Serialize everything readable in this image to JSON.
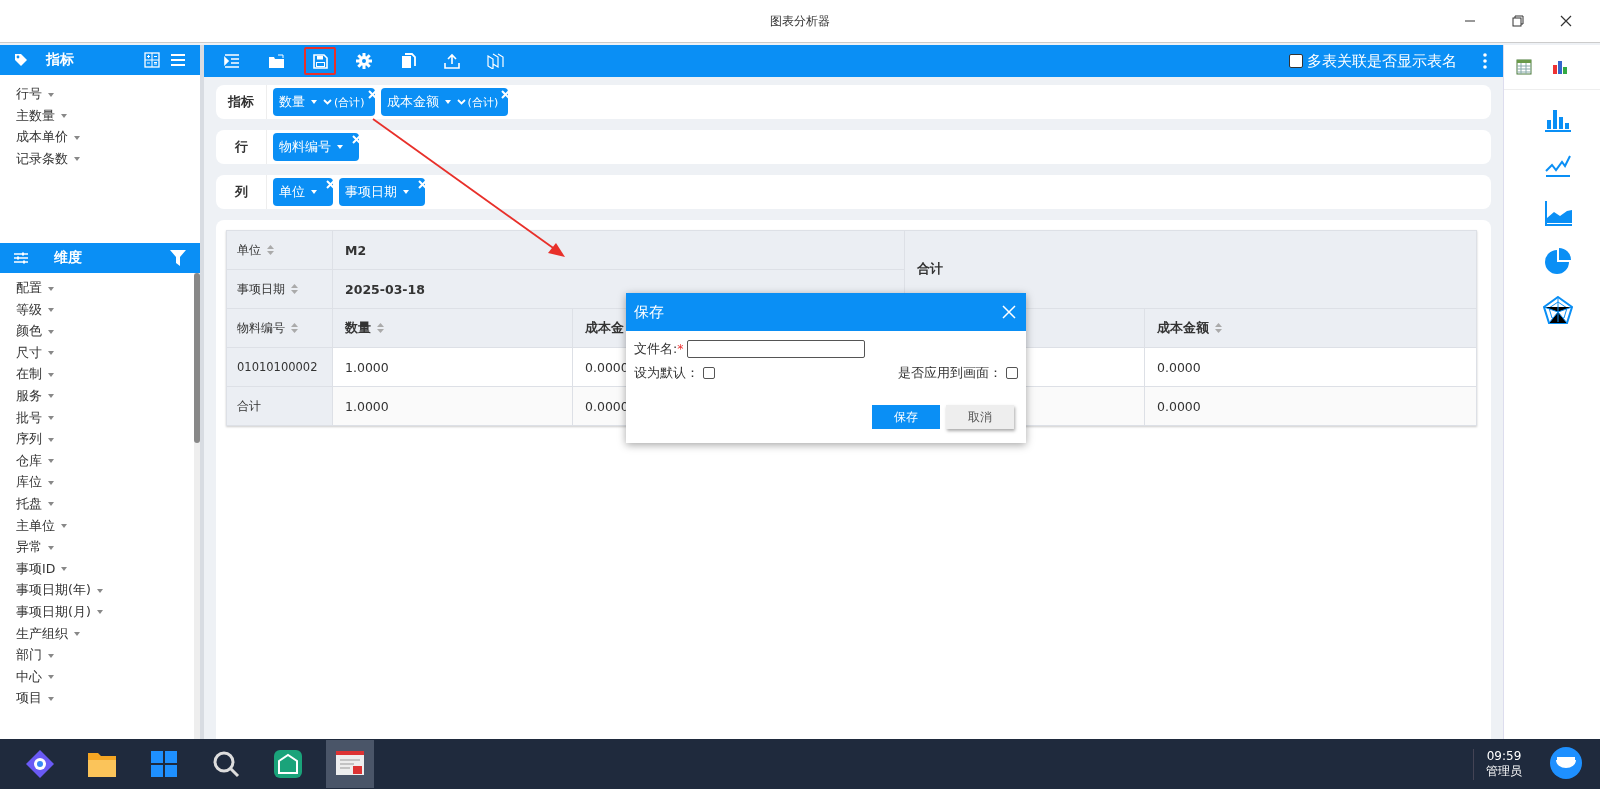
{
  "window": {
    "title": "图表分析器"
  },
  "measures_panel": {
    "title": "指标",
    "items": [
      "行号",
      "主数量",
      "成本单价",
      "记录条数"
    ]
  },
  "dimensions_panel": {
    "title": "维度",
    "items": [
      "配置",
      "等级",
      "颜色",
      "尺寸",
      "在制",
      "服务",
      "批号",
      "序列",
      "仓库",
      "库位",
      "托盘",
      "主单位",
      "异常",
      "事项ID",
      "事项日期(年)",
      "事项日期(月)",
      "生产组织",
      "部门",
      "中心",
      "项目"
    ]
  },
  "toolbar": {
    "buttons": [
      {
        "kind": "indent",
        "highlighted": false
      },
      {
        "kind": "folder",
        "highlighted": false
      },
      {
        "kind": "save",
        "highlighted": true
      },
      {
        "kind": "gear",
        "highlighted": false
      },
      {
        "kind": "copy",
        "highlighted": false
      },
      {
        "kind": "upload",
        "highlighted": false
      },
      {
        "kind": "books",
        "highlighted": false
      }
    ],
    "show_table_names": {
      "label": "多表关联是否显示表名",
      "checked": false
    }
  },
  "zones": [
    {
      "label": "指标",
      "chips": [
        {
          "label": "数量",
          "aggregate": "(合计)"
        },
        {
          "label": "成本金额",
          "aggregate": "(合计)"
        }
      ]
    },
    {
      "label": "行",
      "chips": [
        {
          "label": "物料编号"
        }
      ]
    },
    {
      "label": "列",
      "chips": [
        {
          "label": "单位"
        },
        {
          "label": "事项日期"
        }
      ]
    }
  ],
  "pivot": {
    "column_levels": [
      {
        "label": "单位",
        "value": "M2"
      },
      {
        "label": "事项日期",
        "value": "2025-03-18"
      }
    ],
    "total_header": "合计",
    "row_field": "物料编号",
    "columns": [
      {
        "label": "数量",
        "sortable": true
      },
      {
        "label": "成本金",
        "sortable": false
      }
    ],
    "total_columns": [
      {
        "label": "成本金额",
        "sortable": true
      }
    ],
    "rows": [
      {
        "label": "01010100002",
        "cells": [
          "1.0000",
          "0.0000"
        ],
        "total_cells": [
          "0.0000"
        ]
      },
      {
        "label": "合计",
        "cells": [
          "1.0000",
          "0.0000"
        ],
        "total_cells": [
          "0.0000"
        ]
      }
    ]
  },
  "dialog": {
    "title": "保存",
    "file_name": {
      "label": "文件名:",
      "required_mark": "*"
    },
    "set_default": {
      "label": "设为默认：",
      "checked": false
    },
    "apply_to_screen": {
      "label": "是否应用到画面：",
      "checked": false
    },
    "buttons": [
      {
        "label": "保存",
        "kind": "primary"
      },
      {
        "label": "取消",
        "kind": "secondary"
      }
    ]
  },
  "taskbar": {
    "apps": [
      {
        "kind": "launcher",
        "active": false
      },
      {
        "kind": "files",
        "active": false
      },
      {
        "kind": "tiles",
        "active": false
      },
      {
        "kind": "search",
        "active": false
      },
      {
        "kind": "warehouse",
        "active": false
      },
      {
        "kind": "report",
        "active": true
      }
    ],
    "time": "09:59",
    "user": "管理员"
  }
}
